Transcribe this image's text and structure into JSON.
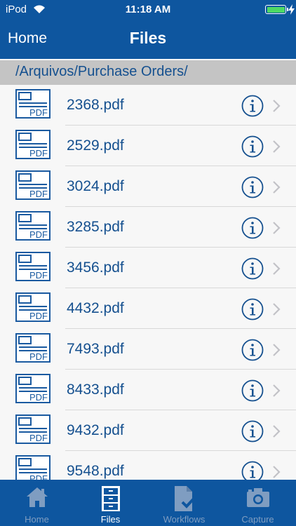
{
  "status_bar": {
    "carrier": "iPod",
    "time": "11:18 AM"
  },
  "nav": {
    "back_label": "Home",
    "title": "Files"
  },
  "path": "/Arquivos/Purchase Orders/",
  "file_icon_label": "PDF",
  "files": [
    {
      "name": "2368.pdf"
    },
    {
      "name": "2529.pdf"
    },
    {
      "name": "3024.pdf"
    },
    {
      "name": "3285.pdf"
    },
    {
      "name": "3456.pdf"
    },
    {
      "name": "4432.pdf"
    },
    {
      "name": "7493.pdf"
    },
    {
      "name": "8433.pdf"
    },
    {
      "name": "9432.pdf"
    },
    {
      "name": "9548.pdf"
    }
  ],
  "tabs": [
    {
      "label": "Home",
      "icon": "home-icon",
      "active": false
    },
    {
      "label": "Files",
      "icon": "file-cabinet-icon",
      "active": true
    },
    {
      "label": "Workflows",
      "icon": "workflow-document-icon",
      "active": false
    },
    {
      "label": "Capture",
      "icon": "camera-icon",
      "active": false
    }
  ],
  "colors": {
    "bar_blue": "#0e569f",
    "text_blue": "#15508f",
    "path_bg": "#c4c4c4",
    "battery_green": "#4cd964",
    "tab_inactive": "#7f9dc1"
  }
}
